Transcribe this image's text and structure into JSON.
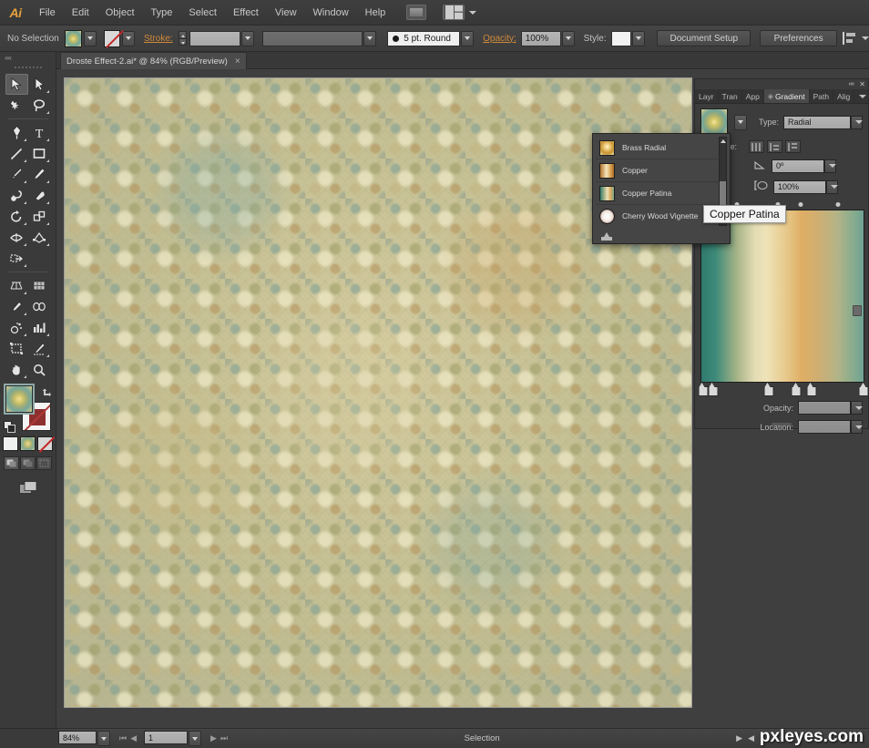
{
  "app": {
    "name": "Ai",
    "menus": [
      "File",
      "Edit",
      "Object",
      "Type",
      "Select",
      "Effect",
      "View",
      "Window",
      "Help"
    ]
  },
  "control_bar": {
    "selection_status": "No Selection",
    "fill_swatch_name": "gradient-fill-swatch",
    "stroke_swatch_name": "none-stroke-swatch",
    "stroke_label": "Stroke:",
    "stroke_weight_value": "",
    "stroke_profile_value": "",
    "brush_value": "5 pt. Round",
    "opacity_label": "Opacity:",
    "opacity_value": "100%",
    "style_label": "Style:",
    "document_setup_label": "Document Setup",
    "preferences_label": "Preferences"
  },
  "document_tab": {
    "title": "Droste Effect-2.ai* @ 84% (RGB/Preview)",
    "close_glyph": "×"
  },
  "tools": [
    {
      "name": "selection-tool",
      "label": "Selection",
      "active": true
    },
    {
      "name": "direct-selection-tool",
      "label": "Direct Selection",
      "active": false
    },
    {
      "name": "magic-wand-tool",
      "label": "Magic Wand",
      "active": false
    },
    {
      "name": "lasso-tool",
      "label": "Lasso",
      "active": false
    },
    {
      "name": "pen-tool",
      "label": "Pen",
      "active": false
    },
    {
      "name": "type-tool",
      "label": "Type",
      "active": false
    },
    {
      "name": "line-segment-tool",
      "label": "Line Segment",
      "active": false
    },
    {
      "name": "rectangle-tool",
      "label": "Rectangle",
      "active": false
    },
    {
      "name": "paintbrush-tool",
      "label": "Paintbrush",
      "active": false
    },
    {
      "name": "pencil-tool",
      "label": "Pencil",
      "active": false
    },
    {
      "name": "blob-brush-tool",
      "label": "Blob Brush",
      "active": false
    },
    {
      "name": "eraser-tool",
      "label": "Eraser",
      "active": false
    },
    {
      "name": "rotate-tool",
      "label": "Rotate",
      "active": false
    },
    {
      "name": "scale-tool",
      "label": "Scale",
      "active": false
    },
    {
      "name": "width-tool",
      "label": "Width",
      "active": false
    },
    {
      "name": "free-transform-tool",
      "label": "Free Transform",
      "active": false
    },
    {
      "name": "shape-builder-tool",
      "label": "Shape Builder",
      "active": false
    },
    {
      "name": "perspective-grid-tool",
      "label": "Perspective Grid",
      "active": false
    },
    {
      "name": "mesh-tool",
      "label": "Mesh",
      "active": false
    },
    {
      "name": "gradient-tool",
      "label": "Gradient",
      "active": false
    },
    {
      "name": "eyedropper-tool",
      "label": "Eyedropper",
      "active": false
    },
    {
      "name": "blend-tool",
      "label": "Blend",
      "active": false
    },
    {
      "name": "symbol-sprayer-tool",
      "label": "Symbol Sprayer",
      "active": false
    },
    {
      "name": "column-graph-tool",
      "label": "Column Graph",
      "active": false
    },
    {
      "name": "artboard-tool",
      "label": "Artboard",
      "active": false
    },
    {
      "name": "slice-tool",
      "label": "Slice",
      "active": false
    },
    {
      "name": "hand-tool",
      "label": "Hand",
      "active": false
    },
    {
      "name": "zoom-tool",
      "label": "Zoom",
      "active": false
    }
  ],
  "gradient_dropdown": {
    "items": [
      {
        "name": "Brass Radial",
        "type": "radial",
        "colors": [
          "#f0dda0",
          "#c99a48",
          "#e8d49a"
        ]
      },
      {
        "name": "Copper",
        "type": "linear",
        "colors": [
          "#c8882f",
          "#f2dfb4",
          "#b8772a"
        ]
      },
      {
        "name": "Copper Patina",
        "type": "linear",
        "colors": [
          "#3d8a78",
          "#d8cf9a",
          "#d3a356"
        ]
      },
      {
        "name": "Cherry Wood Vignette",
        "type": "radial",
        "colors": [
          "#ffffff",
          "#5e1a1a"
        ]
      }
    ],
    "library_button_name": "gradient-libraries-menu"
  },
  "tooltip": {
    "text": "Copper Patina"
  },
  "gradient_panel": {
    "tabs": [
      {
        "label": "Layr",
        "active": false
      },
      {
        "label": "Tran",
        "active": false
      },
      {
        "label": "App",
        "active": false
      },
      {
        "label": "Gradient",
        "active": true
      },
      {
        "label": "Path",
        "active": false
      },
      {
        "label": "Alig",
        "active": false
      }
    ],
    "type_label": "Type:",
    "type_value": "Radial",
    "stroke_label": "Stroke:",
    "angle_value": "0º",
    "aspect_value": "100%",
    "opacity_label": "Opacity:",
    "opacity_value": "",
    "location_label": "Location:",
    "location_value": "",
    "gradient_name": "Copper Patina",
    "stops": [
      {
        "location": 0,
        "color": "#2f7a6e"
      },
      {
        "location": 7,
        "color": "#4c9181"
      },
      {
        "location": 41,
        "color": "#efe3b8"
      },
      {
        "location": 58,
        "color": "#e3c184"
      },
      {
        "location": 67,
        "color": "#d3a356"
      },
      {
        "location": 100,
        "color": "#6fa294"
      }
    ],
    "midpoints": [
      22,
      47,
      61,
      84
    ]
  },
  "canvas": {
    "artboard_name": "droste-effect-artwork",
    "pattern_description": "droste kaleidoscope tiled pattern",
    "base_color": "#cdc79e"
  },
  "status_bar": {
    "zoom_value": "84%",
    "page_value": "1",
    "status_text": "Selection",
    "first_glyph": "⏮",
    "prev_glyph": "◀",
    "next_glyph": "▶",
    "last_glyph": "⏭"
  },
  "watermark": {
    "text": "pxleyes.com"
  }
}
